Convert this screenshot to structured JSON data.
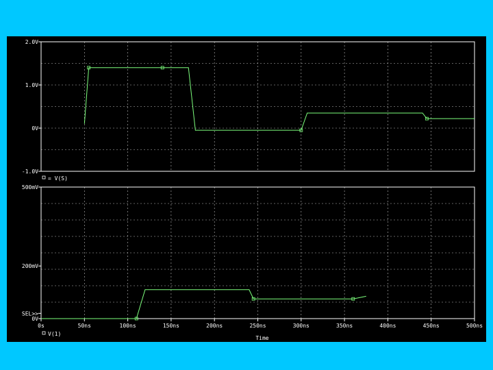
{
  "colors": {
    "background": "#00c8ff",
    "plot_bg": "#000000",
    "axis": "#ffffff",
    "grid": "#bfbfbf",
    "trace": "#7dff7d"
  },
  "chart_data": [
    {
      "type": "line",
      "panel": "top",
      "ylim": [
        -1.0,
        2.0
      ],
      "xlim": [
        0,
        500
      ],
      "y_tick_labels": [
        "2.0V",
        "1.0V",
        "0V",
        "-1.0V"
      ],
      "y_tick_values": [
        2.0,
        1.0,
        0.0,
        -1.0
      ],
      "grid": true,
      "series": [
        {
          "name": "V(S)",
          "marker": "square",
          "x": [
            50,
            55,
            88,
            125,
            140,
            170,
            178,
            250,
            300,
            307,
            375,
            440,
            445,
            500
          ],
          "y": [
            0.1,
            1.4,
            1.4,
            1.4,
            1.4,
            1.4,
            -0.05,
            -0.05,
            -0.05,
            0.35,
            0.35,
            0.35,
            0.22,
            0.22
          ]
        }
      ],
      "marker_labels": [
        "□"
      ]
    },
    {
      "type": "line",
      "panel": "bottom",
      "ylim": [
        0,
        500
      ],
      "xlim": [
        0,
        500
      ],
      "y_tick_labels": [
        "500mV",
        "200mV",
        "SEL>>",
        "0V"
      ],
      "y_tick_values": [
        500,
        200,
        20,
        0
      ],
      "x_tick_labels": [
        "0s",
        "50ns",
        "100ns",
        "150ns",
        "200ns",
        "250ns",
        "300ns",
        "350ns",
        "400ns",
        "450ns",
        "500ns"
      ],
      "x_tick_values": [
        0,
        50,
        100,
        150,
        200,
        250,
        300,
        350,
        400,
        450,
        500
      ],
      "xlabel": "Time",
      "grid": true,
      "series": [
        {
          "name": "V(1)",
          "marker": "square",
          "x": [
            0,
            110,
            120,
            240,
            245,
            300,
            360,
            375
          ],
          "y": [
            0,
            0,
            110,
            110,
            75,
            75,
            75,
            85
          ]
        }
      ],
      "marker_labels": [
        "□"
      ]
    }
  ]
}
